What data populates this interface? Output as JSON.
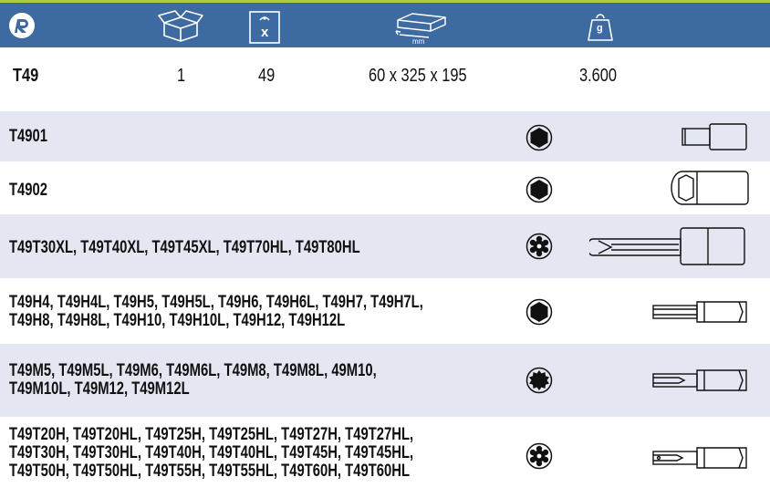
{
  "colors": {
    "header_bg": "#3d6aa0",
    "header_accent": "#b4c93a",
    "row_shade": "#e4e6f2"
  },
  "header": {
    "icons": [
      "brand-logo-icon",
      "box-icon",
      "pieces-x-icon",
      "dimensions-mm-icon",
      "weight-g-icon"
    ],
    "pieces_label": "x",
    "dimensions_unit": "mm",
    "weight_unit": "g"
  },
  "summary": {
    "code": "T49",
    "boxes": "1",
    "pieces": "49",
    "dimensions": "60 x 325 x 195",
    "weight": "3.600"
  },
  "items": [
    {
      "lines": [
        "T4901"
      ],
      "profile_icon": "hex-profile-icon",
      "tool_icon": "bit-adapter-icon"
    },
    {
      "lines": [
        "T4902"
      ],
      "profile_icon": "hex-profile-icon",
      "tool_icon": "hex-socket-icon"
    },
    {
      "lines": [
        "T49T30XL, T49T40XL, T49T45XL, T49T70HL, T49T80HL"
      ],
      "profile_icon": "torx-profile-icon",
      "tool_icon": "torx-socket-bit-icon"
    },
    {
      "lines": [
        "T49H4, T49H4L, T49H5, T49H5L, T49H6, T49H6L, T49H7, T49H7L,",
        "T49H8, T49H8L, T49H10, T49H10L, T49H12, T49H12L"
      ],
      "profile_icon": "hex-profile-icon",
      "tool_icon": "hex-bit-icon"
    },
    {
      "lines": [
        "T49M5, T49M5L, T49M6, T49M6L, T49M8, T49M8L, 49M10,",
        "T49M10L, T49M12, T49M12L"
      ],
      "profile_icon": "spline-profile-icon",
      "tool_icon": "spline-bit-icon"
    },
    {
      "lines": [
        "T49T20H, T49T20HL, T49T25H, T49T25HL, T49T27H, T49T27HL,",
        "T49T30H, T49T30HL, T49T40H, T49T40HL, T49T45H, T49T45HL,",
        "T49T50H, T49T50HL, T49T55H, T49T55HL, T49T60H, T49T60HL"
      ],
      "profile_icon": "torx-profile-icon",
      "tool_icon": "torx-bit-icon"
    }
  ]
}
